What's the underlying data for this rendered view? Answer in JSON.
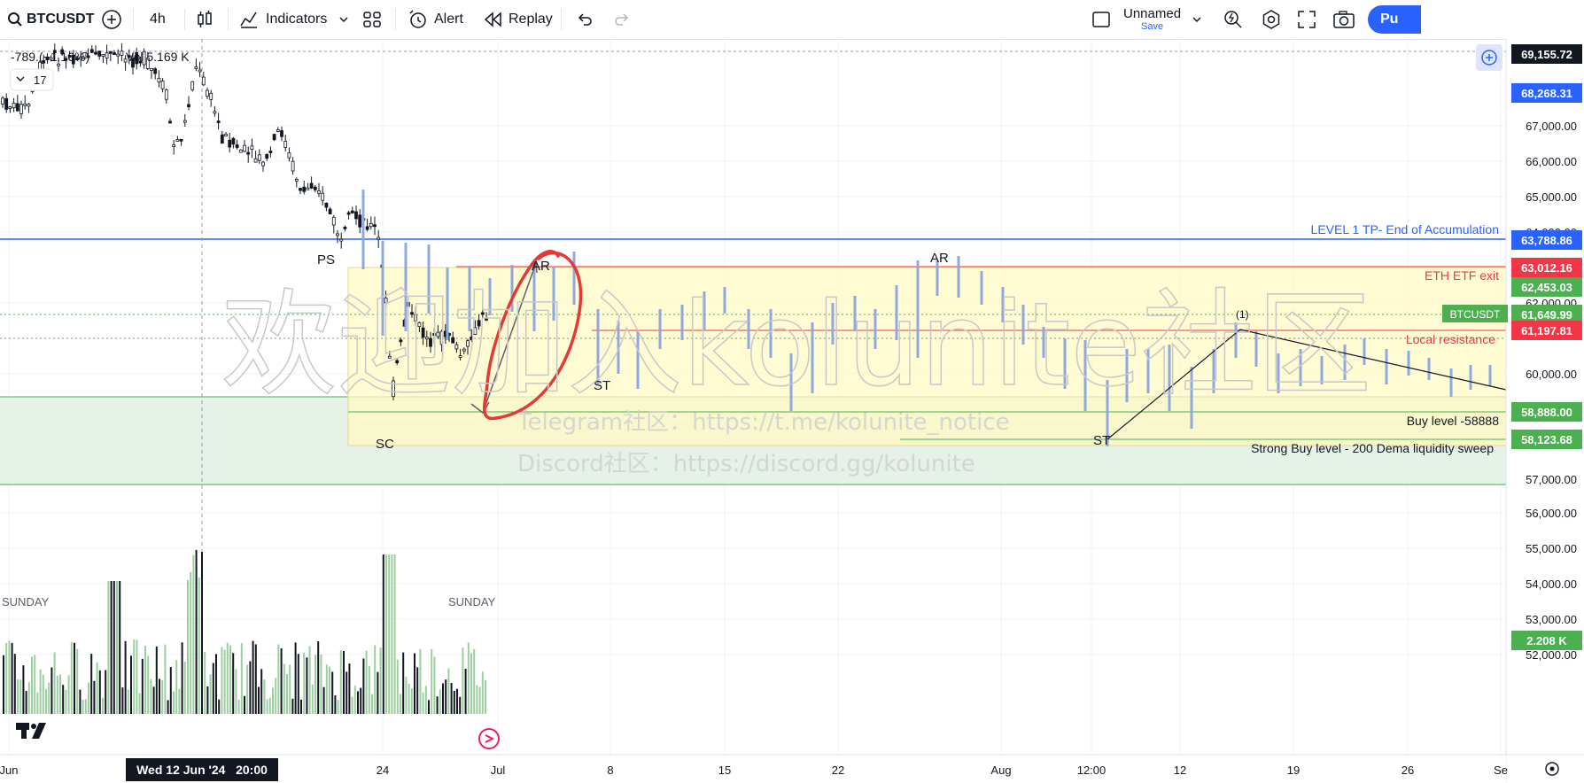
{
  "toolbar": {
    "symbol": "BTCUSDT",
    "interval": "4h",
    "indicators_label": "Indicators",
    "alert_label": "Alert",
    "replay_label": "Replay",
    "layout_name": "Unnamed",
    "save_label": "Save",
    "publish_label": "Pu"
  },
  "legend": {
    "change_text": "-789.(−1.16%)",
    "volume_text": "Vol 5.169 K",
    "indicator_count": "17"
  },
  "watermark": {
    "main": "欢迎加入kolunite社区",
    "telegram": "Telegram社区：https://t.me/kolunite_notice",
    "discord": "Discord社区：https://discord.gg/kolunite"
  },
  "annotations": {
    "ps": "PS",
    "sc": "SC",
    "ar1": "AR",
    "st1": "ST",
    "ar2": "AR",
    "st2": "ST",
    "wave1": "(1)",
    "level1": "LEVEL 1 TP- End of Accumulation",
    "eth_etf": "ETH ETF exit",
    "local_res": "Local resistance",
    "buy_level": "Buy level -58888",
    "strong_buy": "Strong Buy level - 200 Dema liquidity sweep",
    "volume_days": "SUNDAY"
  },
  "price_axis": {
    "ticks": [
      "67,000.00",
      "66,000.00",
      "65,000.00",
      "64,000.00",
      "62,000.00",
      "60,000.00",
      "57,000.00",
      "56,000.00",
      "55,000.00",
      "54,000.00",
      "53,000.00",
      "52,000.00"
    ],
    "tags": {
      "crosshair": "69,155.72",
      "top_blue": "68,268.31",
      "level1": "63,788.86",
      "eth_etf": "63,012.16",
      "green1": "62,453.03",
      "symbol_tag": "BTCUSDT",
      "last": "61,649.99",
      "local_res": "61,197.81",
      "buy": "58,888.00",
      "strong_buy": "58,123.68",
      "volume": "2.208 K"
    }
  },
  "time_axis": {
    "ticks": [
      "Jun",
      "24",
      "Jul",
      "8",
      "15",
      "22",
      "Aug",
      "12:00",
      "12",
      "19",
      "26",
      "Se"
    ],
    "crosshair_label": "Wed 12 Jun '24   20:00"
  },
  "colors": {
    "blue_line": "#2962ff",
    "red_line": "#f23645",
    "green_tag": "#4caf50",
    "yellow_box": "#fff9c4",
    "green_zone": "#e3f1e4",
    "candle_blue": "#90a8e0"
  }
}
